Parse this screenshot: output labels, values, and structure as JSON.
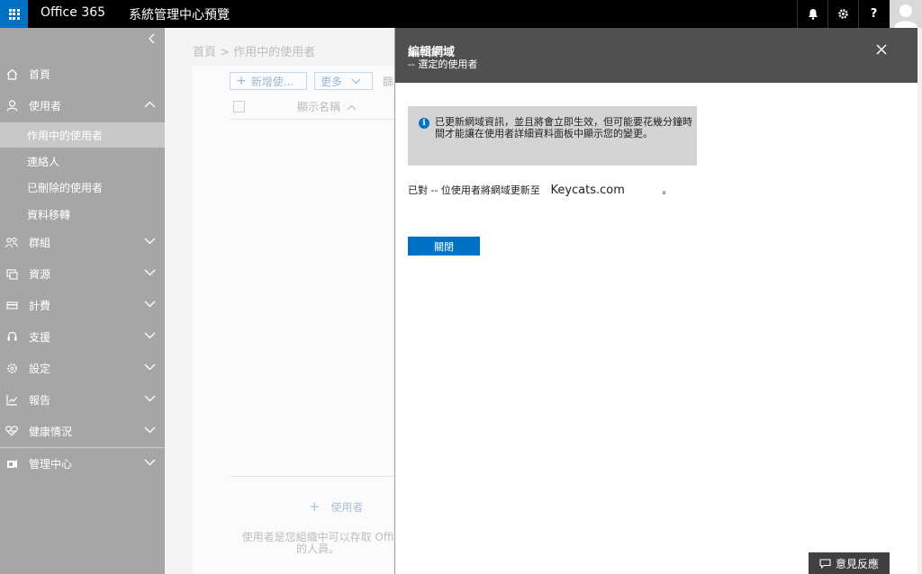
{
  "topbar": {
    "brand": "Office 365",
    "title": "系統管理中心預覽",
    "icons": [
      "bell-icon",
      "gear-icon",
      "help-icon",
      "avatar"
    ],
    "help_label": "?"
  },
  "sidebar": {
    "items": [
      {
        "label": "首頁",
        "icon": "home-icon"
      },
      {
        "label": "使用者",
        "icon": "user-icon",
        "expanded": true
      },
      {
        "label": "群組",
        "icon": "group-icon"
      },
      {
        "label": "資源",
        "icon": "resources-icon"
      },
      {
        "label": "計費",
        "icon": "billing-icon"
      },
      {
        "label": "支援",
        "icon": "support-icon"
      },
      {
        "label": "設定",
        "icon": "settings-icon"
      },
      {
        "label": "報告",
        "icon": "reports-icon"
      },
      {
        "label": "健康情況",
        "icon": "health-icon"
      },
      {
        "label": "管理中心",
        "icon": "admin-center-icon"
      }
    ],
    "subitems": [
      {
        "label": "作用中的使用者",
        "active": true
      },
      {
        "label": "連絡人"
      },
      {
        "label": "已刪除的使用者"
      },
      {
        "label": "資料移轉"
      }
    ]
  },
  "main": {
    "breadcrumb": "首頁 > 作用中的使用者",
    "add_button": "新增使...",
    "more_button": "更多",
    "view_label": "篩",
    "column_display_name": "顯示名稱",
    "add_user_label": "使用者",
    "empty_text_line1": "使用者是您組織中可以存取 Offi",
    "empty_text_line2": "的人員。"
  },
  "flyout": {
    "title": "編輯網域",
    "subtitle": "-- 選定的使用者",
    "info_text": "已更新網域資訊，並且將會立即生效，但可能要花幾分鐘時間才能讓在使用者詳細資料面板中顯示您的變更。",
    "result_prefix": "已對 -- 位使用者將網域更新至",
    "result_domain": "Keycats.com",
    "result_suffix": "。",
    "close_button": "關閉",
    "close_icon": "close-icon",
    "feedback_button": "意見反應"
  },
  "colors": {
    "accent": "#0072c6",
    "topbar": "#000000",
    "sidebar": "#a6a6a6",
    "flyout_header": "#505050"
  }
}
